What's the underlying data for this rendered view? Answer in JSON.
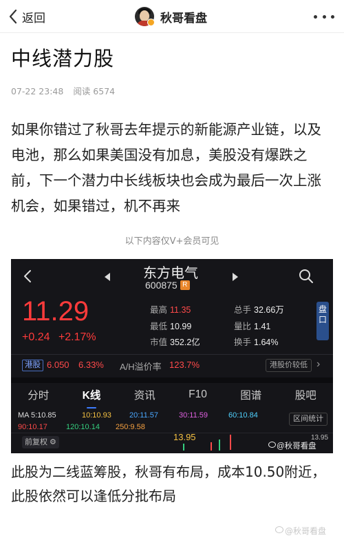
{
  "nav": {
    "back_label": "返回",
    "account_name": "秋哥看盘"
  },
  "article": {
    "title": "中线潜力股",
    "time": "07-22 23:48",
    "reads": "阅读 6574",
    "paragraph1": "如果你错过了秋哥去年提示的新能源产业链，以及电池，那么如果美国没有加息，美股没有爆跌之前，下一个潜力中长线板块也会成为最后一次上涨机会，如果错过，机不再来",
    "vip_note": "以下内容仅V+会员可见",
    "paragraph2": "此股为二线蓝筹股，秋哥有布局，成本10.50附近，此股依然可以逢低分批布局"
  },
  "stock": {
    "name": "东方电气",
    "code": "600875",
    "code_badge": "R",
    "price": "11.29",
    "change": "+0.24",
    "change_pct": "+2.17%",
    "stats": [
      {
        "label": "最高",
        "value": "11.35"
      },
      {
        "label": "总手",
        "value": "32.66万"
      },
      {
        "label": "最低",
        "value": "10.99"
      },
      {
        "label": "量比",
        "value": "1.41"
      },
      {
        "label": "市值",
        "value": "352.2亿"
      },
      {
        "label": "换手",
        "value": "1.64%"
      }
    ],
    "panel_button": "盘口",
    "hk_tag": "港股",
    "hk_price": "6.050",
    "hk_pct": "6.33%",
    "ah_label": "A/H溢价率",
    "ah_value": "123.7%",
    "compare_button": "港股价较低",
    "tabs": [
      "分时",
      "K线",
      "资讯",
      "F10",
      "图谱",
      "股吧"
    ],
    "active_tab": "K线",
    "ma": [
      {
        "text": "MA 5:10.85",
        "color": "#dddddd"
      },
      {
        "text": "10:10.93",
        "color": "#f5c142"
      },
      {
        "text": "20:11.57",
        "color": "#4aa8ff"
      },
      {
        "text": "30:11.59",
        "color": "#e060e0"
      },
      {
        "text": "60:10.84",
        "color": "#4fd1ff"
      },
      {
        "text": "90:10.17",
        "color": "#ff4a4a"
      },
      {
        "text": "120:10.14",
        "color": "#35d07f"
      },
      {
        "text": "250:9.58",
        "color": "#f5a040"
      }
    ],
    "range_button": "区间统计",
    "adjust_button": "前复权",
    "price_mark": "13.95",
    "right_mark": "13.95",
    "watermark": "@秋哥看盘"
  },
  "footer_watermark": "@秋哥看盘",
  "colors": {
    "up_red": "#ff3b3b",
    "dark_bg": "#151519",
    "accent_blue": "#3d7cff"
  }
}
